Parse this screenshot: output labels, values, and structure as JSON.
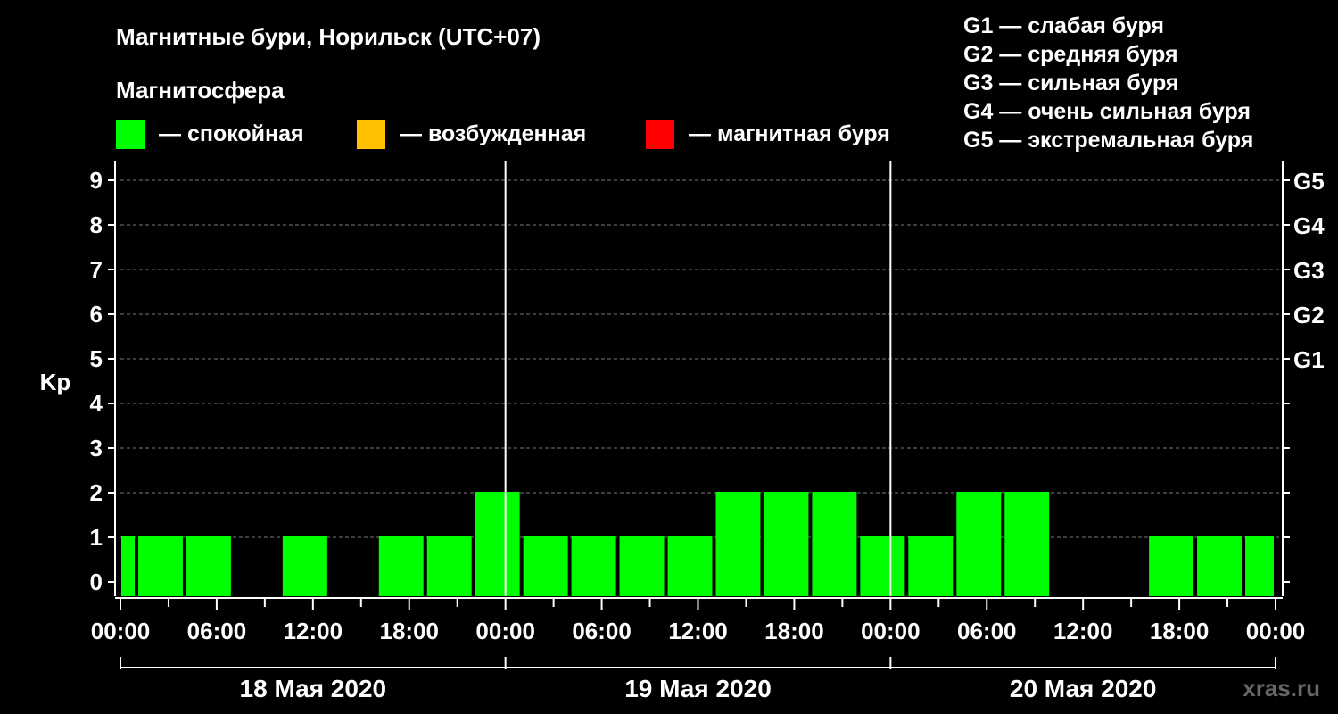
{
  "chart_data": {
    "type": "bar",
    "title": "Магнитные бури, Норильск (UTC+07)",
    "subtitle": "Магнитосфера",
    "ylabel": "Kp",
    "ylim": [
      0,
      9
    ],
    "y_ticks": [
      "0",
      "1",
      "2",
      "3",
      "4",
      "5",
      "6",
      "7",
      "8",
      "9"
    ],
    "g_ticks": [
      {
        "label": "G1",
        "kp": 5
      },
      {
        "label": "G2",
        "kp": 6
      },
      {
        "label": "G3",
        "kp": 7
      },
      {
        "label": "G4",
        "kp": 8
      },
      {
        "label": "G5",
        "kp": 9
      }
    ],
    "x_ticks": [
      "00:00",
      "06:00",
      "12:00",
      "18:00",
      "00:00",
      "06:00",
      "12:00",
      "18:00",
      "00:00",
      "06:00",
      "12:00",
      "18:00",
      "00:00"
    ],
    "dates": [
      "18 Мая 2020",
      "19 Мая 2020",
      "20 Мая 2020"
    ],
    "status_legend": [
      {
        "label": "— спокойная",
        "color": "#00ff00"
      },
      {
        "label": "— возбужденная",
        "color": "#ffc000"
      },
      {
        "label": "— магнитная буря",
        "color": "#ff0000"
      }
    ],
    "storm_scale": [
      "G1 — слабая буря",
      "G2 — средняя буря",
      "G3 — сильная буря",
      "G4 — очень сильная буря",
      "G5 — экстремальная буря"
    ],
    "grid": true,
    "bar_color": "#00ff00",
    "series": [
      {
        "values": [
          {
            "start_hour": 0,
            "end_hour": 1,
            "kp": 1
          },
          {
            "start_hour": 1,
            "end_hour": 4,
            "kp": 1
          },
          {
            "start_hour": 4,
            "end_hour": 7,
            "kp": 1
          },
          {
            "start_hour": 7,
            "end_hour": 10,
            "kp": 0
          },
          {
            "start_hour": 10,
            "end_hour": 13,
            "kp": 1
          },
          {
            "start_hour": 13,
            "end_hour": 16,
            "kp": 0
          },
          {
            "start_hour": 16,
            "end_hour": 19,
            "kp": 1
          },
          {
            "start_hour": 19,
            "end_hour": 22,
            "kp": 1
          },
          {
            "start_hour": 22,
            "end_hour": 25,
            "kp": 2
          },
          {
            "start_hour": 25,
            "end_hour": 28,
            "kp": 1
          },
          {
            "start_hour": 28,
            "end_hour": 31,
            "kp": 1
          },
          {
            "start_hour": 31,
            "end_hour": 34,
            "kp": 1
          },
          {
            "start_hour": 34,
            "end_hour": 37,
            "kp": 1
          },
          {
            "start_hour": 37,
            "end_hour": 40,
            "kp": 2
          },
          {
            "start_hour": 40,
            "end_hour": 43,
            "kp": 2
          },
          {
            "start_hour": 43,
            "end_hour": 46,
            "kp": 2
          },
          {
            "start_hour": 46,
            "end_hour": 49,
            "kp": 1
          },
          {
            "start_hour": 49,
            "end_hour": 52,
            "kp": 1
          },
          {
            "start_hour": 52,
            "end_hour": 55,
            "kp": 2
          },
          {
            "start_hour": 55,
            "end_hour": 58,
            "kp": 2
          },
          {
            "start_hour": 58,
            "end_hour": 61,
            "kp": 0
          },
          {
            "start_hour": 61,
            "end_hour": 64,
            "kp": 0
          },
          {
            "start_hour": 64,
            "end_hour": 67,
            "kp": 1
          },
          {
            "start_hour": 67,
            "end_hour": 70,
            "kp": 1
          },
          {
            "start_hour": 70,
            "end_hour": 72,
            "kp": 1
          }
        ]
      }
    ]
  },
  "site": "xras.ru"
}
